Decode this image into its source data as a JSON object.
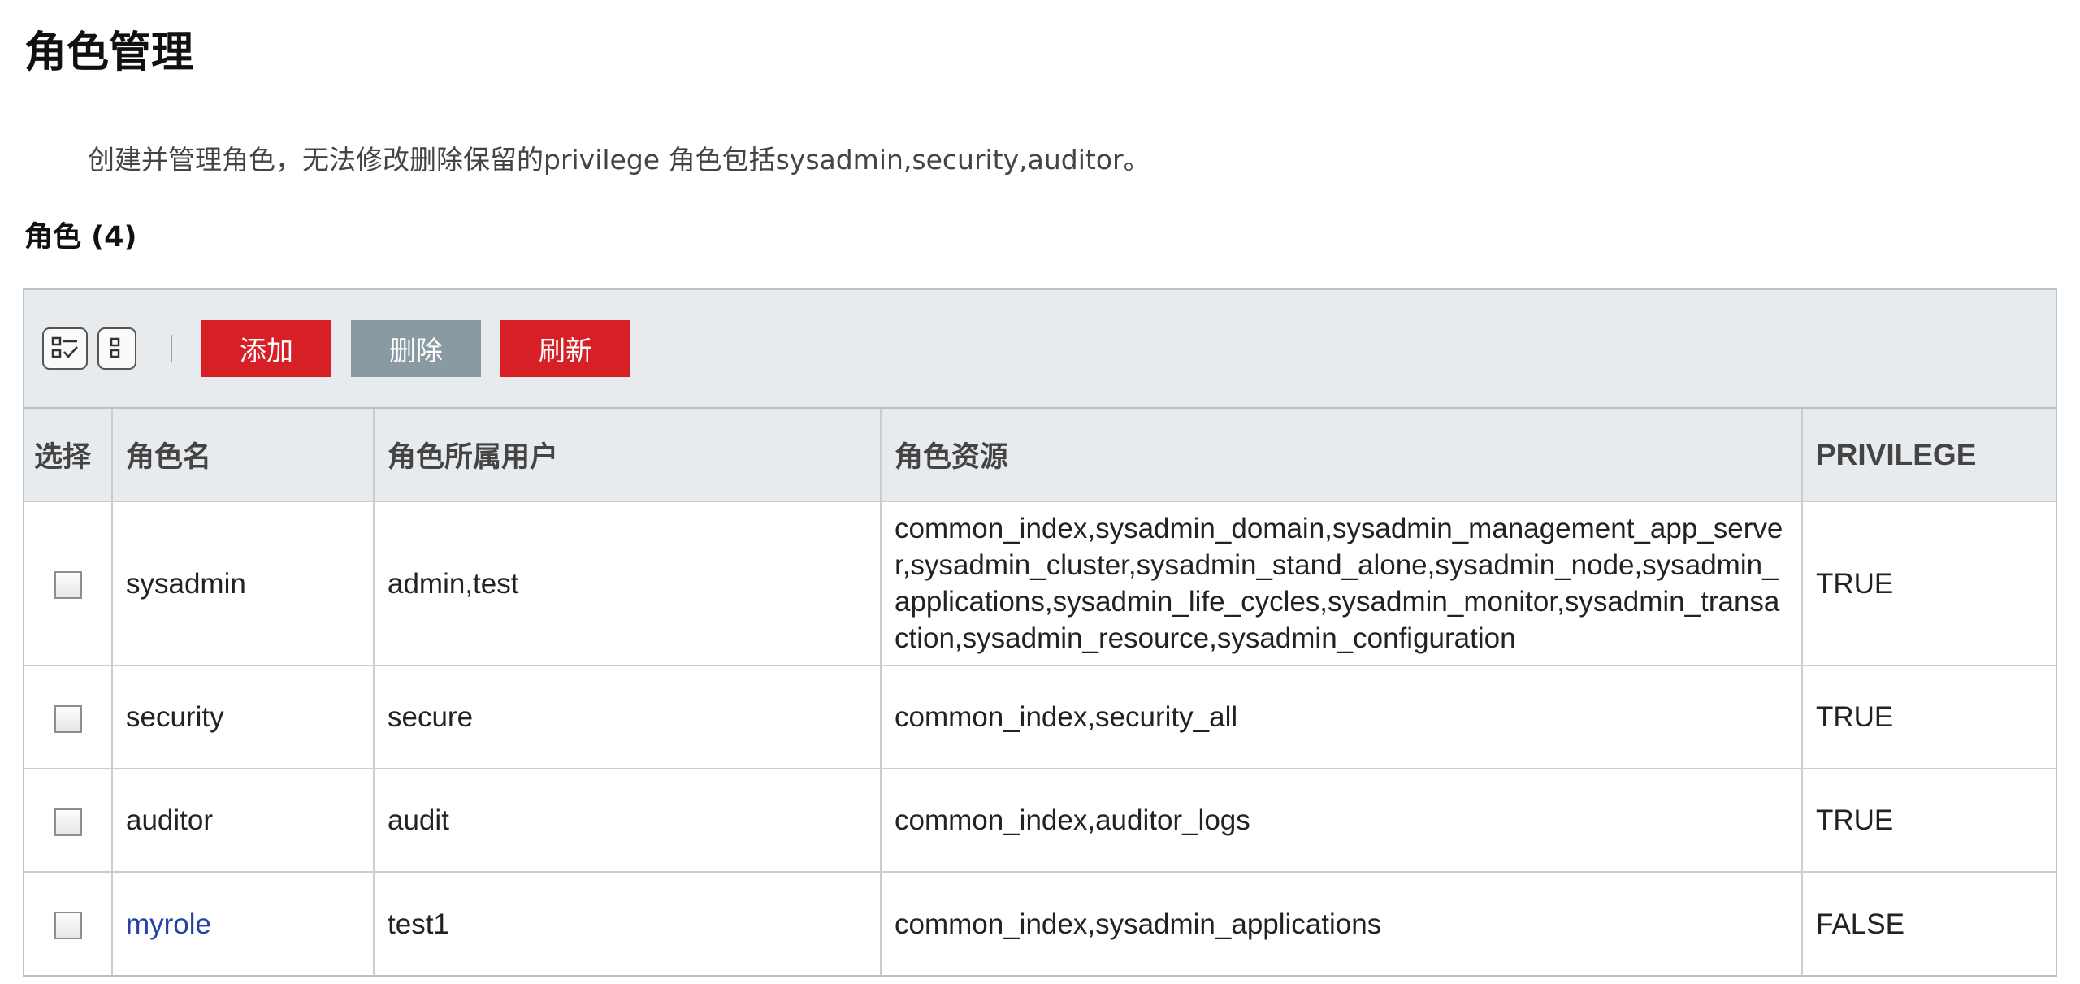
{
  "page": {
    "title": "角色管理",
    "description": "创建并管理角色，无法修改删除保留的privilege 角色包括sysadmin,security,auditor。",
    "section_title": "角色 (4)"
  },
  "toolbar": {
    "select_all_icon": "select-all-icon",
    "column_icon": "column-settings-icon",
    "add_label": "添加",
    "delete_label": "删除",
    "refresh_label": "刷新",
    "colors": {
      "primary": "#d71f26",
      "disabled": "#8a9aa2"
    }
  },
  "table": {
    "headers": {
      "select": "选择",
      "name": "角色名",
      "users": "角色所属用户",
      "resources": "角色资源",
      "privilege": "PRIVILEGE"
    },
    "rows": [
      {
        "name": "sysadmin",
        "users": "admin,test",
        "resources": "common_index,sysadmin_domain,sysadmin_management_app_server,sysadmin_cluster,sysadmin_stand_alone,sysadmin_node,sysadmin_applications,sysadmin_life_cycles,sysadmin_monitor,sysadmin_transaction,sysadmin_resource,sysadmin_configuration",
        "privilege": "TRUE"
      },
      {
        "name": "security",
        "users": "secure",
        "resources": "common_index,security_all",
        "privilege": "TRUE"
      },
      {
        "name": "auditor",
        "users": "audit",
        "resources": "common_index,auditor_logs",
        "privilege": "TRUE"
      },
      {
        "name": "myrole",
        "users": "test1",
        "resources": "common_index,sysadmin_applications",
        "privilege": "FALSE"
      }
    ]
  }
}
